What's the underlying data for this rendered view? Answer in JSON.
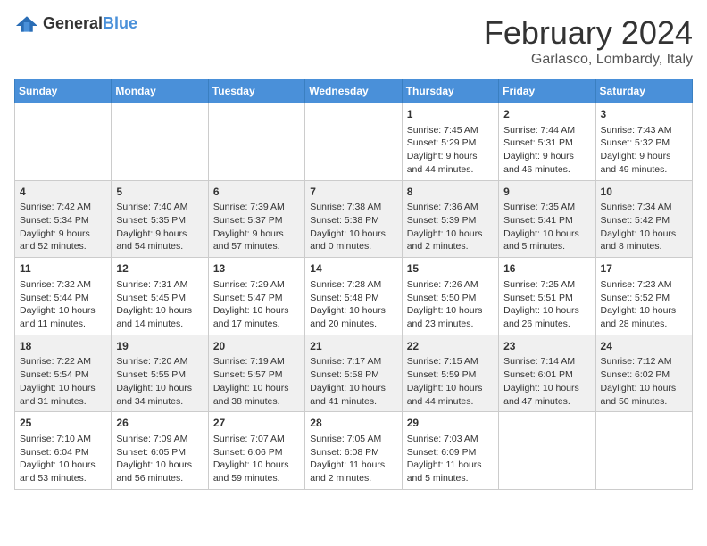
{
  "header": {
    "logo_general": "General",
    "logo_blue": "Blue",
    "main_title": "February 2024",
    "sub_title": "Garlasco, Lombardy, Italy"
  },
  "columns": [
    "Sunday",
    "Monday",
    "Tuesday",
    "Wednesday",
    "Thursday",
    "Friday",
    "Saturday"
  ],
  "weeks": [
    [
      {
        "day": "",
        "info": ""
      },
      {
        "day": "",
        "info": ""
      },
      {
        "day": "",
        "info": ""
      },
      {
        "day": "",
        "info": ""
      },
      {
        "day": "1",
        "info": "Sunrise: 7:45 AM\nSunset: 5:29 PM\nDaylight: 9 hours\nand 44 minutes."
      },
      {
        "day": "2",
        "info": "Sunrise: 7:44 AM\nSunset: 5:31 PM\nDaylight: 9 hours\nand 46 minutes."
      },
      {
        "day": "3",
        "info": "Sunrise: 7:43 AM\nSunset: 5:32 PM\nDaylight: 9 hours\nand 49 minutes."
      }
    ],
    [
      {
        "day": "4",
        "info": "Sunrise: 7:42 AM\nSunset: 5:34 PM\nDaylight: 9 hours\nand 52 minutes."
      },
      {
        "day": "5",
        "info": "Sunrise: 7:40 AM\nSunset: 5:35 PM\nDaylight: 9 hours\nand 54 minutes."
      },
      {
        "day": "6",
        "info": "Sunrise: 7:39 AM\nSunset: 5:37 PM\nDaylight: 9 hours\nand 57 minutes."
      },
      {
        "day": "7",
        "info": "Sunrise: 7:38 AM\nSunset: 5:38 PM\nDaylight: 10 hours\nand 0 minutes."
      },
      {
        "day": "8",
        "info": "Sunrise: 7:36 AM\nSunset: 5:39 PM\nDaylight: 10 hours\nand 2 minutes."
      },
      {
        "day": "9",
        "info": "Sunrise: 7:35 AM\nSunset: 5:41 PM\nDaylight: 10 hours\nand 5 minutes."
      },
      {
        "day": "10",
        "info": "Sunrise: 7:34 AM\nSunset: 5:42 PM\nDaylight: 10 hours\nand 8 minutes."
      }
    ],
    [
      {
        "day": "11",
        "info": "Sunrise: 7:32 AM\nSunset: 5:44 PM\nDaylight: 10 hours\nand 11 minutes."
      },
      {
        "day": "12",
        "info": "Sunrise: 7:31 AM\nSunset: 5:45 PM\nDaylight: 10 hours\nand 14 minutes."
      },
      {
        "day": "13",
        "info": "Sunrise: 7:29 AM\nSunset: 5:47 PM\nDaylight: 10 hours\nand 17 minutes."
      },
      {
        "day": "14",
        "info": "Sunrise: 7:28 AM\nSunset: 5:48 PM\nDaylight: 10 hours\nand 20 minutes."
      },
      {
        "day": "15",
        "info": "Sunrise: 7:26 AM\nSunset: 5:50 PM\nDaylight: 10 hours\nand 23 minutes."
      },
      {
        "day": "16",
        "info": "Sunrise: 7:25 AM\nSunset: 5:51 PM\nDaylight: 10 hours\nand 26 minutes."
      },
      {
        "day": "17",
        "info": "Sunrise: 7:23 AM\nSunset: 5:52 PM\nDaylight: 10 hours\nand 28 minutes."
      }
    ],
    [
      {
        "day": "18",
        "info": "Sunrise: 7:22 AM\nSunset: 5:54 PM\nDaylight: 10 hours\nand 31 minutes."
      },
      {
        "day": "19",
        "info": "Sunrise: 7:20 AM\nSunset: 5:55 PM\nDaylight: 10 hours\nand 34 minutes."
      },
      {
        "day": "20",
        "info": "Sunrise: 7:19 AM\nSunset: 5:57 PM\nDaylight: 10 hours\nand 38 minutes."
      },
      {
        "day": "21",
        "info": "Sunrise: 7:17 AM\nSunset: 5:58 PM\nDaylight: 10 hours\nand 41 minutes."
      },
      {
        "day": "22",
        "info": "Sunrise: 7:15 AM\nSunset: 5:59 PM\nDaylight: 10 hours\nand 44 minutes."
      },
      {
        "day": "23",
        "info": "Sunrise: 7:14 AM\nSunset: 6:01 PM\nDaylight: 10 hours\nand 47 minutes."
      },
      {
        "day": "24",
        "info": "Sunrise: 7:12 AM\nSunset: 6:02 PM\nDaylight: 10 hours\nand 50 minutes."
      }
    ],
    [
      {
        "day": "25",
        "info": "Sunrise: 7:10 AM\nSunset: 6:04 PM\nDaylight: 10 hours\nand 53 minutes."
      },
      {
        "day": "26",
        "info": "Sunrise: 7:09 AM\nSunset: 6:05 PM\nDaylight: 10 hours\nand 56 minutes."
      },
      {
        "day": "27",
        "info": "Sunrise: 7:07 AM\nSunset: 6:06 PM\nDaylight: 10 hours\nand 59 minutes."
      },
      {
        "day": "28",
        "info": "Sunrise: 7:05 AM\nSunset: 6:08 PM\nDaylight: 11 hours\nand 2 minutes."
      },
      {
        "day": "29",
        "info": "Sunrise: 7:03 AM\nSunset: 6:09 PM\nDaylight: 11 hours\nand 5 minutes."
      },
      {
        "day": "",
        "info": ""
      },
      {
        "day": "",
        "info": ""
      }
    ]
  ]
}
